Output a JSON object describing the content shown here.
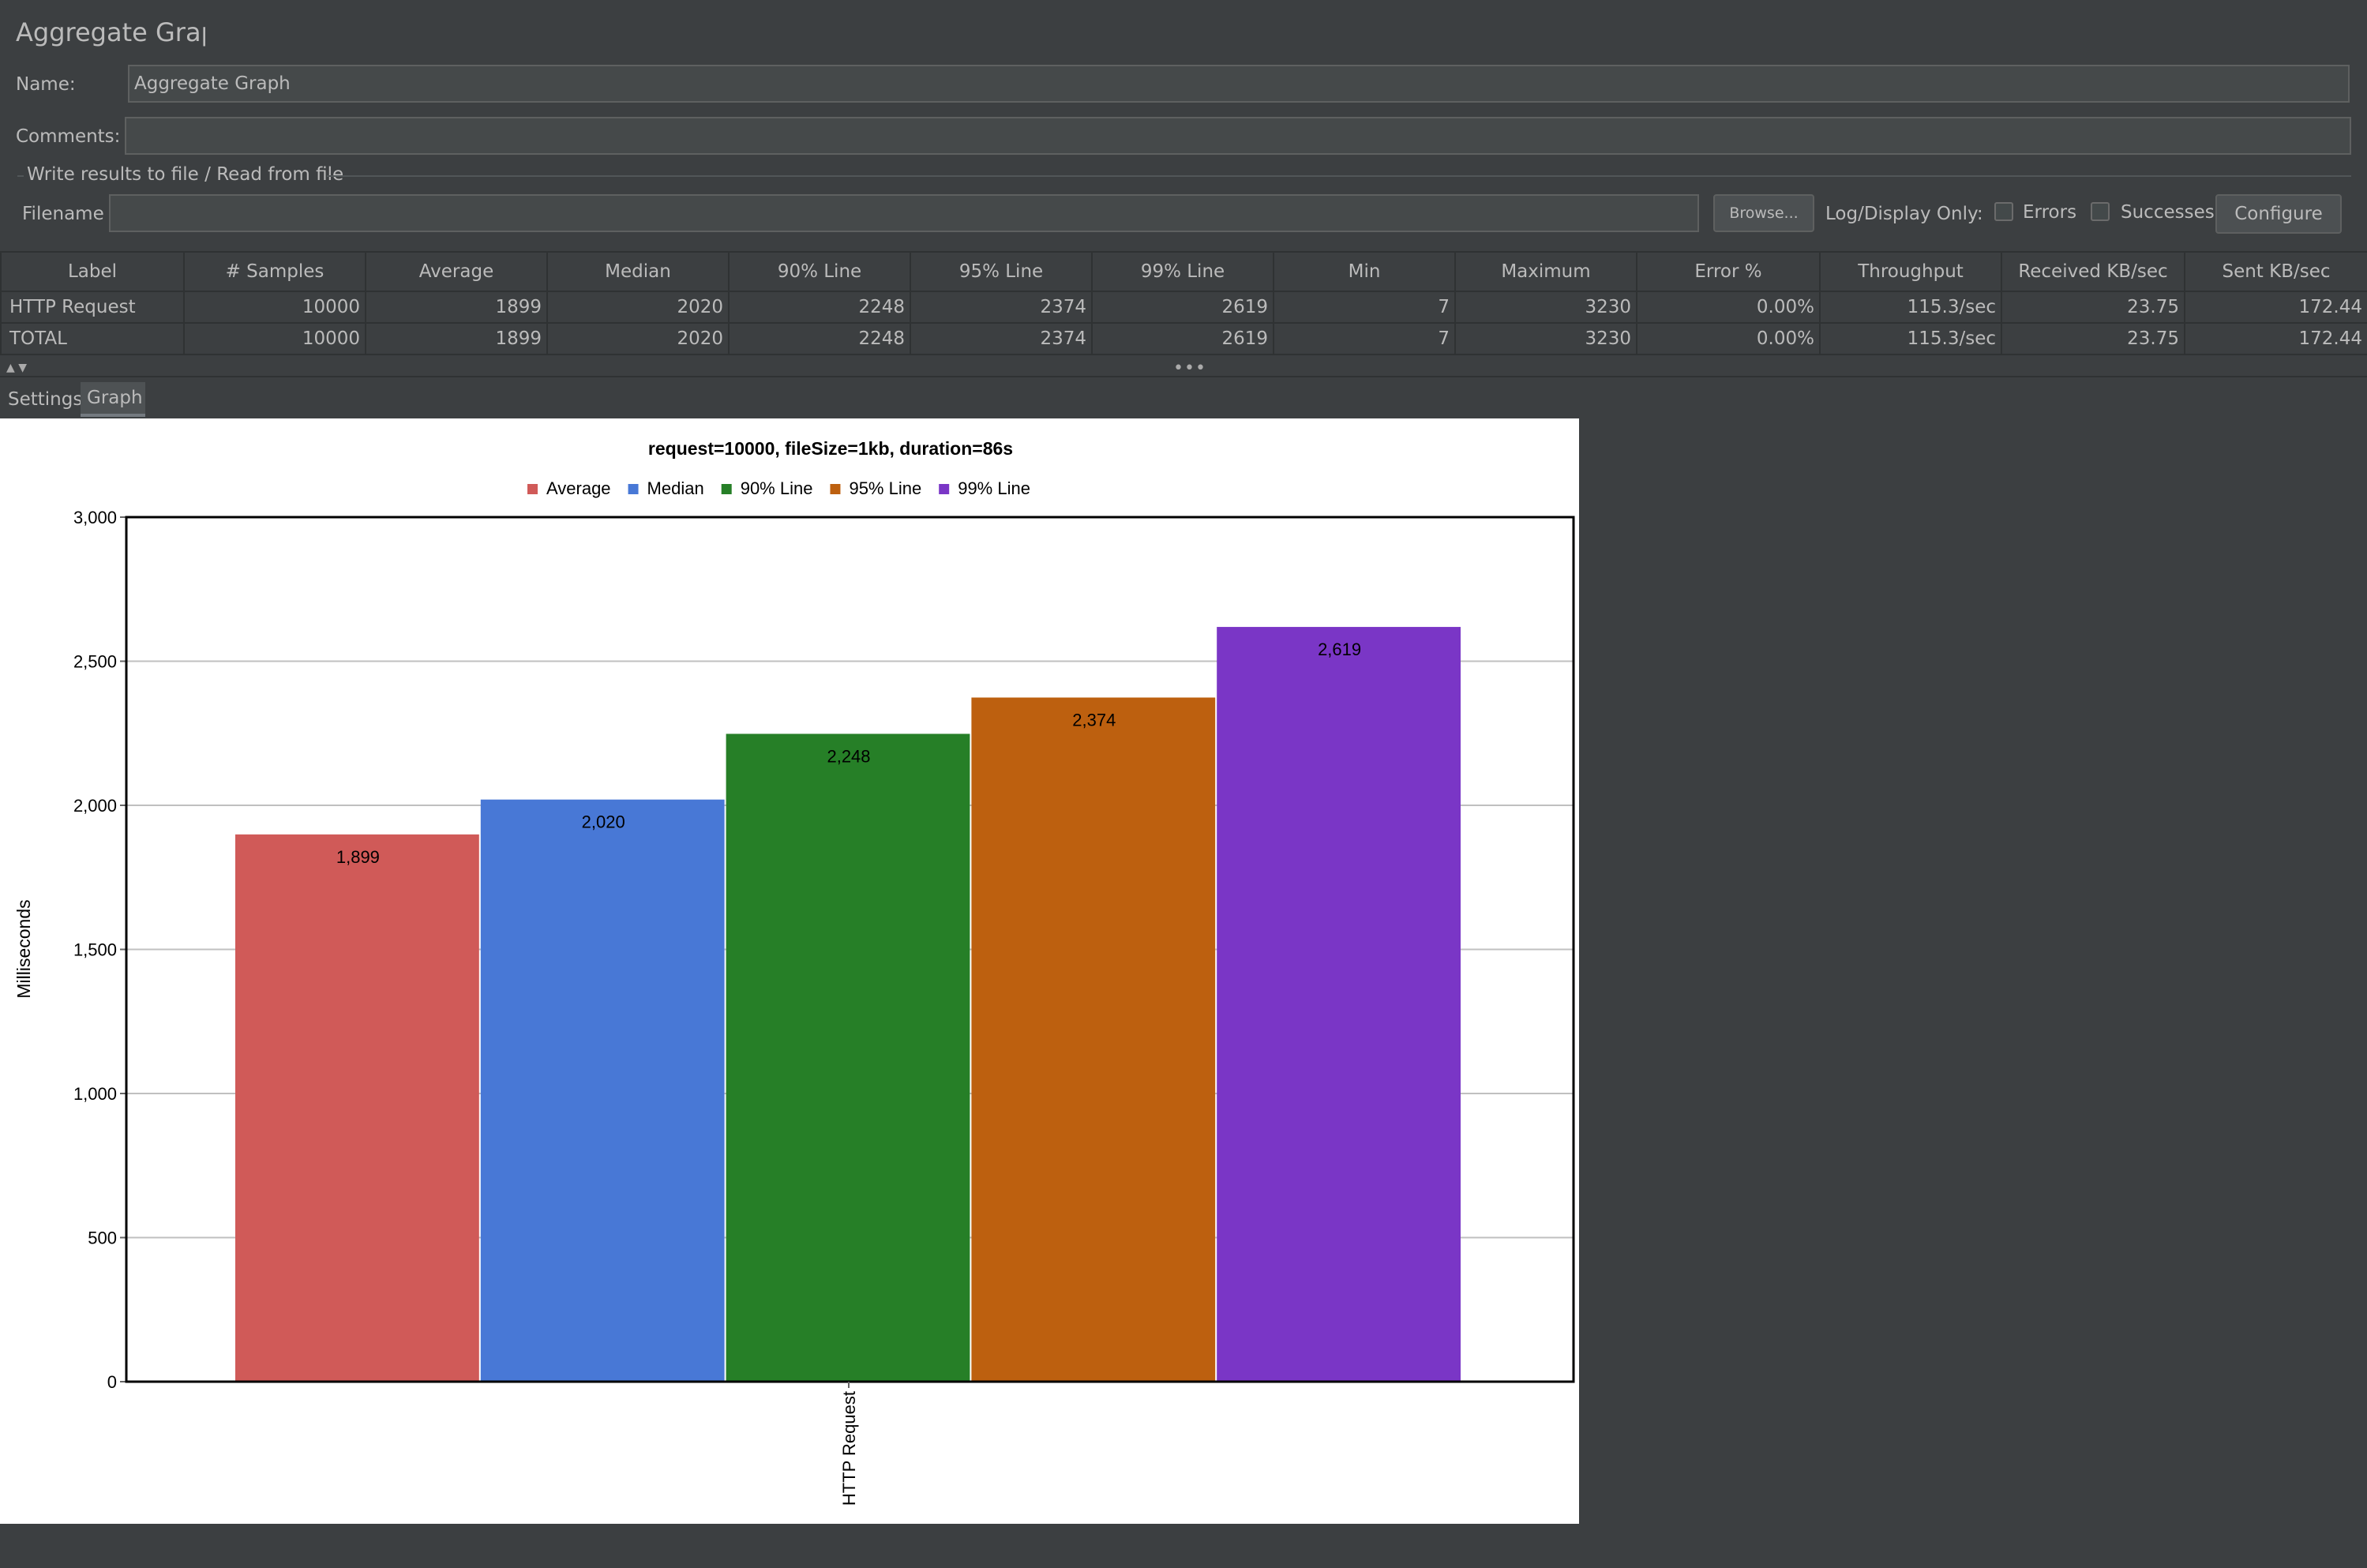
{
  "panel": {
    "title": "Aggregate Graph"
  },
  "form": {
    "name_label": "Name:",
    "name_value": "Aggregate Graph",
    "comments_label": "Comments:",
    "comments_value": "",
    "file_group_label": "Write results to file / Read from file",
    "filename_label": "Filename",
    "filename_value": "",
    "browse_label": "Browse...",
    "log_display_label": "Log/Display Only:",
    "errors_label": "Errors",
    "successes_label": "Successes",
    "configure_label": "Configure"
  },
  "table": {
    "columns": [
      "Label",
      "# Samples",
      "Average",
      "Median",
      "90% Line",
      "95% Line",
      "99% Line",
      "Min",
      "Maximum",
      "Error %",
      "Throughput",
      "Received KB/sec",
      "Sent KB/sec"
    ],
    "rows": [
      [
        "HTTP Request",
        "10000",
        "1899",
        "2020",
        "2248",
        "2374",
        "2619",
        "7",
        "3230",
        "0.00%",
        "115.3/sec",
        "23.75",
        "172.44"
      ],
      [
        "TOTAL",
        "10000",
        "1899",
        "2020",
        "2248",
        "2374",
        "2619",
        "7",
        "3230",
        "0.00%",
        "115.3/sec",
        "23.75",
        "172.44"
      ]
    ]
  },
  "tabs": [
    {
      "label": "Settings",
      "active": false
    },
    {
      "label": "Graph",
      "active": true
    }
  ],
  "chart_data": {
    "type": "bar",
    "title": "request=10000, fileSize=1kb, duration=86s",
    "xlabel": "",
    "ylabel": "Milliseconds",
    "ylim": [
      0,
      3000
    ],
    "yticks": [
      0,
      500,
      1000,
      1500,
      2000,
      2500,
      3000
    ],
    "ytick_labels": [
      "0",
      "500",
      "1,000",
      "1,500",
      "2,000",
      "2,500",
      "3,000"
    ],
    "categories": [
      "HTTP Request"
    ],
    "legend_position": "top",
    "grid": true,
    "series": [
      {
        "name": "Average",
        "values": [
          1899
        ],
        "label": "1,899",
        "color": "#d05a58"
      },
      {
        "name": "Median",
        "values": [
          2020
        ],
        "label": "2,020",
        "color": "#4878d6"
      },
      {
        "name": "90% Line",
        "values": [
          2248
        ],
        "label": "2,248",
        "color": "#267f27"
      },
      {
        "name": "95% Line",
        "values": [
          2374
        ],
        "label": "2,374",
        "color": "#bd600f"
      },
      {
        "name": "99% Line",
        "values": [
          2619
        ],
        "label": "2,619",
        "color": "#7a36c6"
      }
    ]
  }
}
